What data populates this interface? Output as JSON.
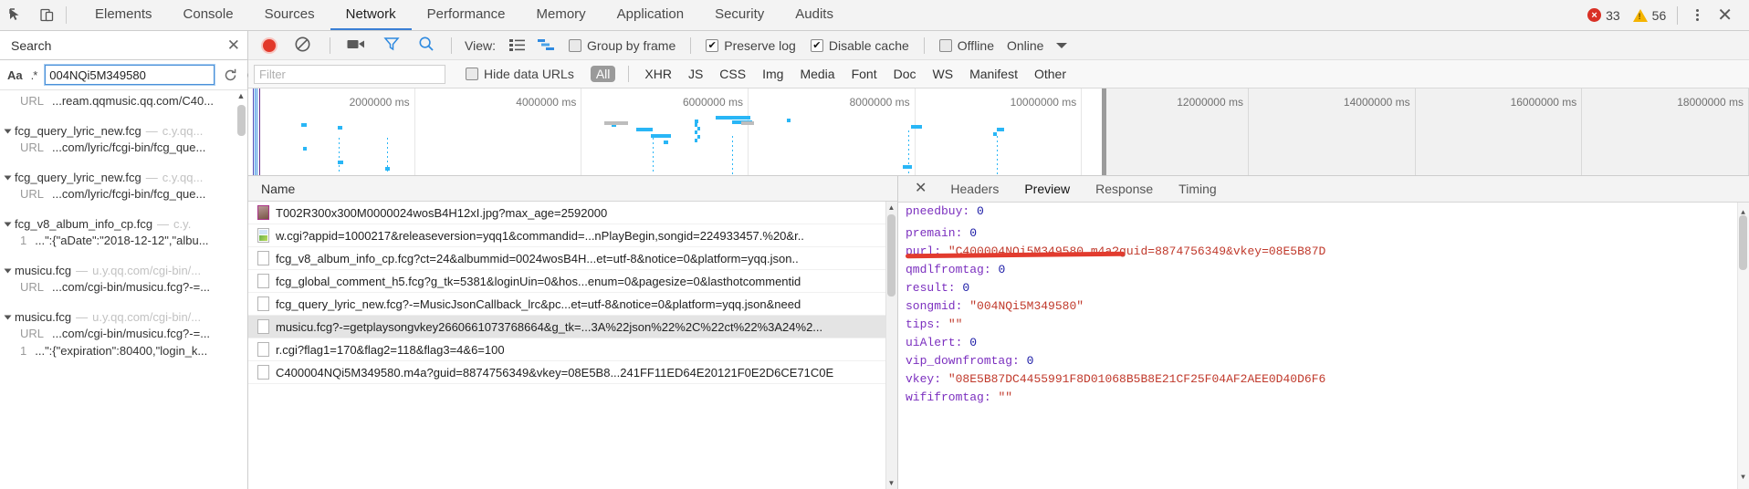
{
  "devtools": {
    "main_tabs": [
      {
        "label": "Elements",
        "active": false
      },
      {
        "label": "Console",
        "active": false
      },
      {
        "label": "Sources",
        "active": false
      },
      {
        "label": "Network",
        "active": true
      },
      {
        "label": "Performance",
        "active": false
      },
      {
        "label": "Memory",
        "active": false
      },
      {
        "label": "Application",
        "active": false
      },
      {
        "label": "Security",
        "active": false
      },
      {
        "label": "Audits",
        "active": false
      }
    ],
    "error_count": "33",
    "warning_count": "56",
    "inspect_icon": "inspect-element-icon",
    "device_icon": "toggle-device-toolbar-icon",
    "more_icon": "more-options-icon",
    "close_icon": "close-devtools-icon"
  },
  "search_pane": {
    "title": "Search",
    "close_icon": "close-search-icon",
    "match_case_label": "Aa",
    "regex_label": ".*",
    "query": "004NQi5M349580",
    "refresh_icon": "refresh-search-icon",
    "clear_icon": "clear-search-icon",
    "results": [
      {
        "type": "url",
        "label": "URL",
        "value": "...ream.qqmusic.qq.com/C40..."
      },
      {
        "type": "file",
        "name": "fcg_query_lyric_new.fcg",
        "host": "c.y.qq..."
      },
      {
        "type": "url",
        "label": "URL",
        "value": "...com/lyric/fcgi-bin/fcg_que..."
      },
      {
        "type": "file",
        "name": "fcg_query_lyric_new.fcg",
        "host": "c.y.qq..."
      },
      {
        "type": "url",
        "label": "URL",
        "value": "...com/lyric/fcgi-bin/fcg_que..."
      },
      {
        "type": "file",
        "name": "fcg_v8_album_info_cp.fcg",
        "host": "c.y."
      },
      {
        "type": "url",
        "label": "1",
        "value": "...\":{\"aDate\":\"2018-12-12\",\"albu..."
      },
      {
        "type": "file",
        "name": "musicu.fcg",
        "host": "u.y.qq.com/cgi-bin/..."
      },
      {
        "type": "url",
        "label": "URL",
        "value": "...com/cgi-bin/musicu.fcg?-=..."
      },
      {
        "type": "file",
        "name": "musicu.fcg",
        "host": "u.y.qq.com/cgi-bin/..."
      },
      {
        "type": "url",
        "label": "URL",
        "value": "...com/cgi-bin/musicu.fcg?-=..."
      },
      {
        "type": "url",
        "label": "1",
        "value": "...\":{\"expiration\":80400,\"login_k..."
      }
    ]
  },
  "network_toolbar": {
    "record_icon": "record-button",
    "clear_icon": "clear-button",
    "capture_screenshots_icon": "camera-icon",
    "filter_icon": "filter-funnel-icon",
    "search_icon": "search-magnifier-icon",
    "view_label": "View:",
    "view_list_icon": "list-view-icon",
    "view_waterfall_icon": "waterfall-view-icon",
    "group_by_frame": {
      "label": "Group by frame",
      "checked": false
    },
    "preserve_log": {
      "label": "Preserve log",
      "checked": true
    },
    "disable_cache": {
      "label": "Disable cache",
      "checked": true
    },
    "offline": {
      "label": "Offline",
      "checked": false
    },
    "online_label": "Online",
    "throttle_caret_icon": "chevron-down-icon"
  },
  "filter_row": {
    "placeholder": "Filter",
    "value": "",
    "hide_data_urls": {
      "label": "Hide data URLs",
      "checked": false
    },
    "types": [
      "All",
      "XHR",
      "JS",
      "CSS",
      "Img",
      "Media",
      "Font",
      "Doc",
      "WS",
      "Manifest",
      "Other"
    ],
    "active_type": "All"
  },
  "overview": {
    "ticks": [
      "2000000 ms",
      "4000000 ms",
      "6000000 ms",
      "8000000 ms",
      "10000000 ms",
      "12000000 ms",
      "14000000 ms",
      "16000000 ms",
      "18000000 ms"
    ],
    "selection_end_label": "12000000 ms"
  },
  "requests": {
    "column_header": "Name",
    "rows": [
      {
        "name": "T002R300x300M0000024wosB4H12xI.jpg?max_age=2592000",
        "icon": "image-file-icon",
        "selected": false
      },
      {
        "name": "w.cgi?appid=1000217&releaseversion=yqq1&commandid=...nPlayBegin,songid=224933457.%20&r..",
        "icon": "document-file-icon",
        "selected": false
      },
      {
        "name": "fcg_v8_album_info_cp.fcg?ct=24&albummid=0024wosB4H...et=utf-8&notice=0&platform=yqq.json..",
        "icon": "generic-file-icon",
        "selected": false
      },
      {
        "name": "fcg_global_comment_h5.fcg?g_tk=5381&loginUin=0&hos...enum=0&pagesize=0&lasthotcommentid",
        "icon": "generic-file-icon",
        "selected": false
      },
      {
        "name": "fcg_query_lyric_new.fcg?-=MusicJsonCallback_lrc&pc...et=utf-8&notice=0&platform=yqq.json&need",
        "icon": "generic-file-icon",
        "selected": false
      },
      {
        "name": "musicu.fcg?-=getplaysongvkey2660661073768664&g_tk=...3A%22json%22%2C%22ct%22%3A24%2...",
        "icon": "generic-file-icon",
        "selected": true
      },
      {
        "name": "r.cgi?flag1=170&flag2=118&flag3=4&6=100",
        "icon": "generic-file-icon",
        "selected": false
      },
      {
        "name": "C400004NQi5M349580.m4a?guid=8874756349&vkey=08E5B8...241FF11ED64E20121F0E2D6CE71C0E",
        "icon": "generic-file-icon",
        "selected": false
      }
    ]
  },
  "detail": {
    "close_icon": "close-detail-icon",
    "tabs": [
      {
        "label": "Headers",
        "active": false
      },
      {
        "label": "Preview",
        "active": true
      },
      {
        "label": "Response",
        "active": false
      },
      {
        "label": "Timing",
        "active": false
      }
    ],
    "preview_lines": [
      {
        "key": "pneedbuy:",
        "value": "0",
        "value_type": "num",
        "clipped": true
      },
      {
        "key": "premain:",
        "value": "0",
        "value_type": "num"
      },
      {
        "key": "purl:",
        "value": "\"C400004NQi5M349580.m4a?guid=8874756349&vkey=08E5B87D",
        "value_type": "str",
        "highlighted": true
      },
      {
        "key": "qmdlfromtag:",
        "value": "0",
        "value_type": "num"
      },
      {
        "key": "result:",
        "value": "0",
        "value_type": "num"
      },
      {
        "key": "songmid:",
        "value": "\"004NQi5M349580\"",
        "value_type": "str"
      },
      {
        "key": "tips:",
        "value": "\"\"",
        "value_type": "str"
      },
      {
        "key": "uiAlert:",
        "value": "0",
        "value_type": "num"
      },
      {
        "key": "vip_downfromtag:",
        "value": "0",
        "value_type": "num"
      },
      {
        "key": "vkey:",
        "value": "\"08E5B87DC4455991F8D01068B5B8E21CF25F04AF2AEE0D40D6F6",
        "value_type": "str"
      },
      {
        "key": "wififromtag:",
        "value": "\"\"",
        "value_type": "str"
      }
    ],
    "annotation_color": "#e23b2e"
  }
}
